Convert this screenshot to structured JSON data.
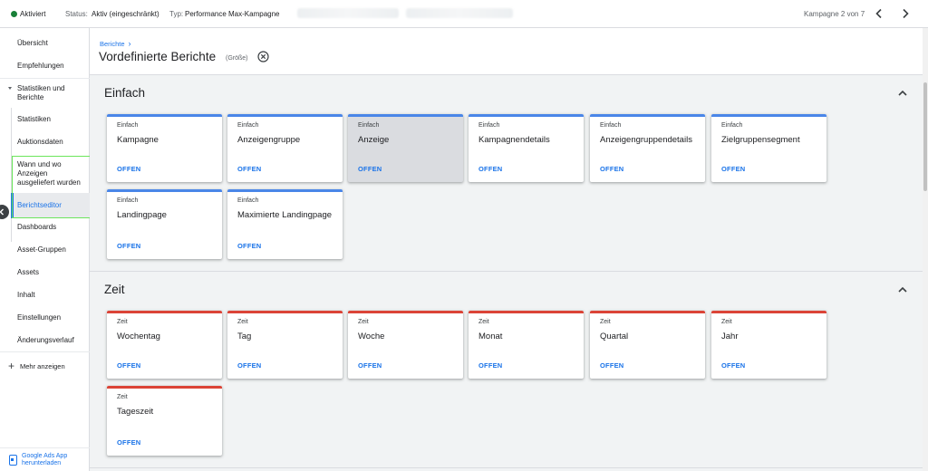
{
  "topbar": {
    "activated": "Aktiviert",
    "status_label": "Status:",
    "status_value": "Aktiv (eingeschränkt)",
    "type_label": "Typ:",
    "type_value": "Performance Max-Kampagne",
    "campaign_count": "Kampagne 2 von 7",
    "status_color": "#188038"
  },
  "sidebar": {
    "items": [
      {
        "label": "Übersicht"
      },
      {
        "label": "Empfehlungen"
      },
      {
        "label": "Statistiken und Berichte"
      },
      {
        "label": "Statistiken"
      },
      {
        "label": "Auktionsdaten"
      },
      {
        "label": "Wann und wo Anzeigen ausgeliefert wurden"
      },
      {
        "label": "Berichtseditor"
      },
      {
        "label": "Dashboards"
      },
      {
        "label": "Asset-Gruppen"
      },
      {
        "label": "Assets"
      },
      {
        "label": "Inhalt"
      },
      {
        "label": "Einstellungen"
      },
      {
        "label": "Änderungsverlauf"
      }
    ],
    "more_label": "Mehr anzeigen",
    "app_download": "Google Ads App herunterladen"
  },
  "header": {
    "breadcrumb": "Berichte",
    "title": "Vordefinierte Berichte",
    "size_note": "(Größe)"
  },
  "sections": [
    {
      "title": "Einfach",
      "accent": "#4a86e8",
      "cards": [
        {
          "category": "Einfach",
          "name": "Kampagne",
          "action": "OFFEN"
        },
        {
          "category": "Einfach",
          "name": "Anzeigengruppe",
          "action": "OFFEN"
        },
        {
          "category": "Einfach",
          "name": "Anzeige",
          "action": "OFFEN"
        },
        {
          "category": "Einfach",
          "name": "Kampagnendetails",
          "action": "OFFEN"
        },
        {
          "category": "Einfach",
          "name": "Anzeigengruppendetails",
          "action": "OFFEN"
        },
        {
          "category": "Einfach",
          "name": "Zielgruppensegment",
          "action": "OFFEN"
        },
        {
          "category": "Einfach",
          "name": "Landingpage",
          "action": "OFFEN"
        },
        {
          "category": "Einfach",
          "name": "Maximierte Landingpage",
          "action": "OFFEN"
        }
      ]
    },
    {
      "title": "Zeit",
      "accent": "#db4437",
      "cards": [
        {
          "category": "Zeit",
          "name": "Wochentag",
          "action": "OFFEN"
        },
        {
          "category": "Zeit",
          "name": "Tag",
          "action": "OFFEN"
        },
        {
          "category": "Zeit",
          "name": "Woche",
          "action": "OFFEN"
        },
        {
          "category": "Zeit",
          "name": "Monat",
          "action": "OFFEN"
        },
        {
          "category": "Zeit",
          "name": "Quartal",
          "action": "OFFEN"
        },
        {
          "category": "Zeit",
          "name": "Jahr",
          "action": "OFFEN"
        },
        {
          "category": "Zeit",
          "name": "Tageszeit",
          "action": "OFFEN"
        }
      ]
    }
  ]
}
